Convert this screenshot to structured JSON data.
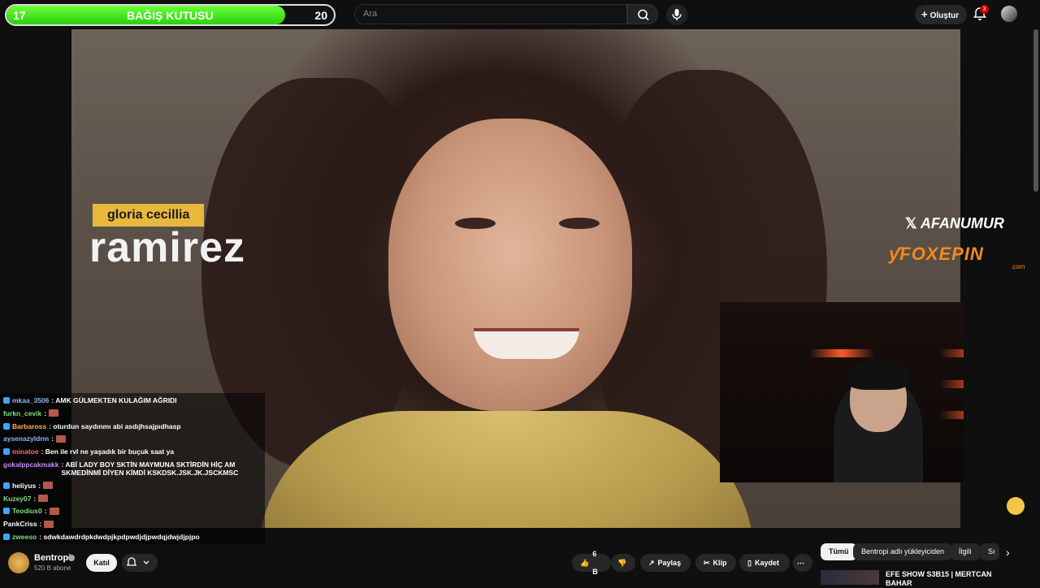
{
  "donation": {
    "left": "17",
    "title": "BAĞIŞ KUTUSU",
    "right": "20",
    "progress": 0.85
  },
  "search": {
    "placeholder": "Ara"
  },
  "header": {
    "create_label": "Oluştur",
    "notification_count": "3"
  },
  "video": {
    "name_small": "gloria cecillia",
    "name_large": "ramirez"
  },
  "overlay": {
    "social_handle": "AFANUMUR",
    "sponsor": "FOXEPIN",
    "sponsor_sub": ".com"
  },
  "chat": [
    {
      "user": "mkaa_3506",
      "color": "#8ab4f8",
      "msg": ": AMK GÜLMEKTEN KULAĞIM AĞRIDI",
      "emote": false
    },
    {
      "user": "furkn_cevik",
      "color": "#7fe07f",
      "msg": ":",
      "emote": true
    },
    {
      "user": "Barbaross",
      "color": "#ffb347",
      "msg": ": oturdun saydınmı abi asdıjhsajpıdhasp",
      "emote": false
    },
    {
      "user": "aysenazyldrm",
      "color": "#8ab4f8",
      "msg": ":",
      "emote": true
    },
    {
      "user": "minatoe",
      "color": "#ff6b6b",
      "msg": ": Ben ile rvl ne yaşadık bir buçuk saat ya",
      "emote": false
    },
    {
      "user": "gokalppcakmakk",
      "color": "#c58af9",
      "msg": ": ABİ LADY BOY SKTİN MAYMUNA SKTİRDİN HİÇ AM SKMEDİNMİ DİYEN KİMDİ KSKDSK.JSK.JK.JSCKMSC",
      "emote": false
    },
    {
      "user": "heliyus",
      "color": "#ffffff",
      "msg": ":",
      "emote": true
    },
    {
      "user": "Kuzey07",
      "color": "#7fe07f",
      "msg": ":",
      "emote": true
    },
    {
      "user": "Teodius0",
      "color": "#7fe07f",
      "msg": ":",
      "emote": true
    },
    {
      "user": "PankCriss",
      "color": "#ffffff",
      "msg": ":",
      "emote": true
    },
    {
      "user": "zweeso",
      "color": "#7fe07f",
      "msg": ": sdwkdawdrdpkdwdpjkpdpwdjdjpwdqjdwjdjpjpo",
      "emote": false
    }
  ],
  "channel": {
    "name": "Bentropi",
    "subscribers": "520 B abone",
    "join_label": "Katıl"
  },
  "actions": {
    "likes": "6 B",
    "share": "Paylaş",
    "clip": "Klip",
    "save": "Kaydet"
  },
  "chips": [
    "Tümü",
    "Bentropi adlı yükleyiciden",
    "İlgili",
    "Sı"
  ],
  "recommended": {
    "title": "EFE SHOW S3B15 | MERTCAN BAHAR"
  }
}
